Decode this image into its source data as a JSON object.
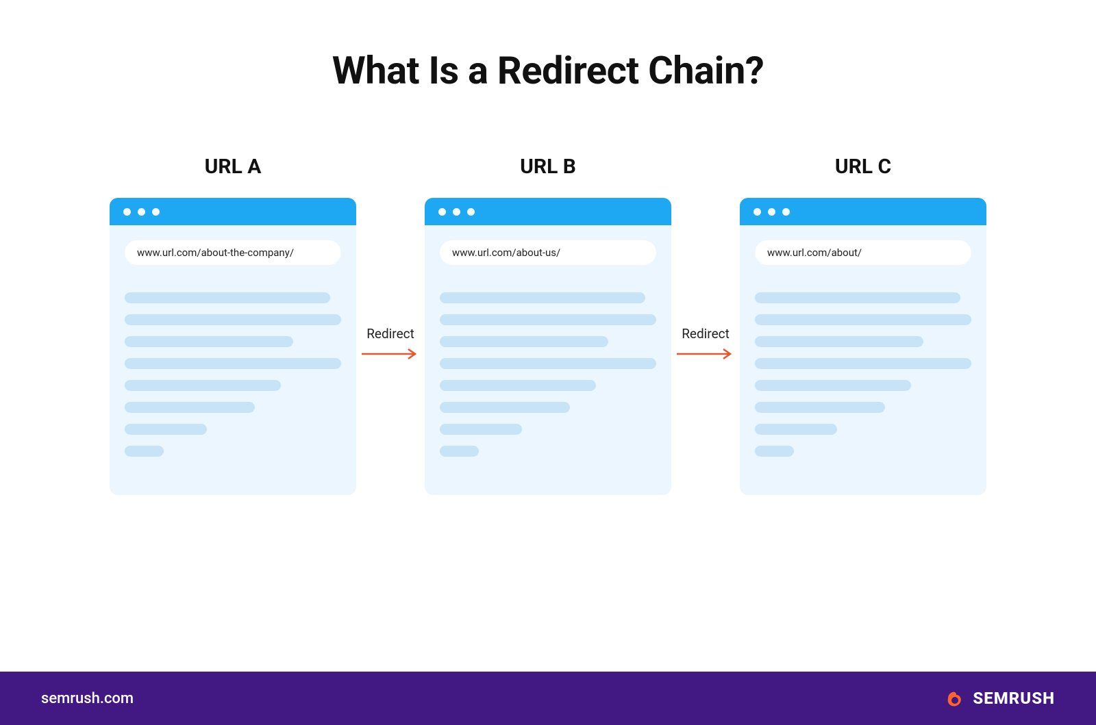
{
  "title": "What Is a Redirect Chain?",
  "columns": [
    {
      "label": "URL A",
      "url": "www.url.com/about-the-company/"
    },
    {
      "label": "URL B",
      "url": "www.url.com/about-us/"
    },
    {
      "label": "URL C",
      "url": "www.url.com/about/"
    }
  ],
  "connector_label": "Redirect",
  "footer": {
    "site": "semrush.com",
    "brand": "SEMRUSH"
  },
  "colors": {
    "header_blue": "#1EA7F3",
    "panel_bg": "#ECF6FE",
    "line_fill": "#C7E4F7",
    "footer_purple": "#421983",
    "arrow_orange": "#E8552D"
  },
  "line_widths": [
    95,
    100,
    78,
    100,
    72,
    60,
    38,
    18
  ]
}
